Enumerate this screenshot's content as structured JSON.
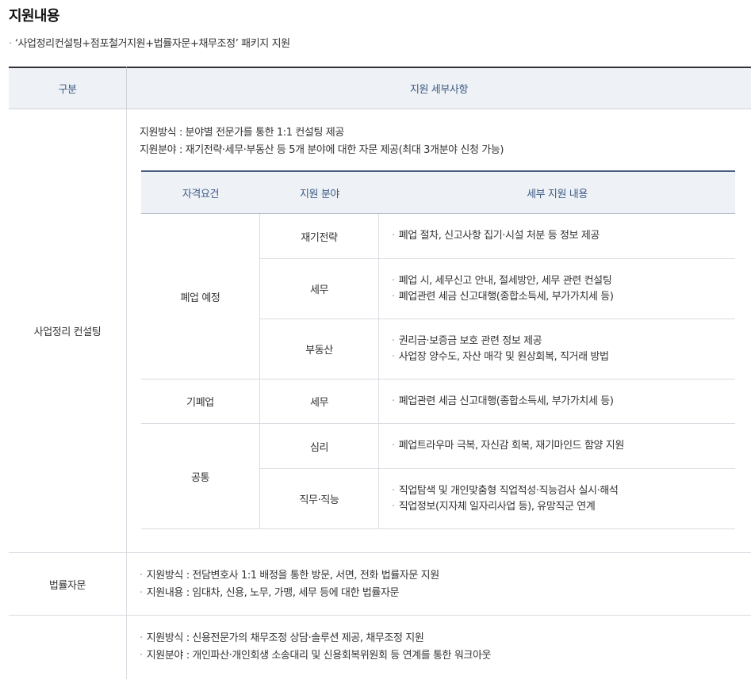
{
  "title": "지원내용",
  "subtitle": "‘사업정리컨설팅+점포철거지원+법률자문+채무조정’ 패키지 지원",
  "header": {
    "col1": "구분",
    "col2": "지원 세부사항"
  },
  "consulting": {
    "label": "사업정리 컨설팅",
    "method": "지원방식 : 분야별 전문가를 통한 1:1 컨설팅 제공",
    "field": "지원분야 : 재기전략·세무·부동산 등 5개 분야에 대한 자문 제공(최대 3개분야 신청 가능)",
    "table": {
      "headers": [
        "자격요건",
        "지원 분야",
        "세부 지원 내용"
      ],
      "groups": [
        "폐업 예정",
        "기폐업",
        "공통"
      ],
      "rows": [
        {
          "field": "재기전략",
          "details": [
            "폐업 절차, 신고사항 집기·시설 처분 등 정보 제공"
          ]
        },
        {
          "field": "세무",
          "details": [
            "폐업 시, 세무신고 안내, 절세방안, 세무 관련 컨설팅",
            "폐업관련 세금 신고대행(종합소득세, 부가가치세 등)"
          ]
        },
        {
          "field": "부동산",
          "details": [
            "권리금·보증금 보호 관련 정보 제공",
            "사업장 양수도, 자산 매각 및 원상회복, 직거래 방법"
          ]
        },
        {
          "field": "세무",
          "details": [
            "폐업관련 세금 신고대행(종합소득세, 부가가치세 등)"
          ]
        },
        {
          "field": "심리",
          "details": [
            "폐업트라우마 극복, 자신감 회복, 재기마인드 함양 지원"
          ]
        },
        {
          "field": "직무·직능",
          "details": [
            "직업탐색 및 개인맞춤형 직업적성·직능검사 실시·해석",
            "직업정보(지자체 일자리사업 등), 유망직군 연계"
          ]
        }
      ]
    }
  },
  "legal": {
    "label": "법률자문",
    "lines": [
      "지원방식 : 전담변호사 1:1 배정을 통한 방문, 서면, 전화 법률자문 지원",
      "지원내용 : 임대차, 신용, 노무, 가맹, 세무 등에 대한 법률자문"
    ]
  },
  "debt": {
    "lines": [
      "지원방식 : 신용전문가의 채무조정 상담·솔루션 제공, 채무조정 지원",
      "지원분야 : 개인파산·개인회생 소송대리 및 신용회복위원회 등 연계를 통한 워크아웃"
    ]
  }
}
